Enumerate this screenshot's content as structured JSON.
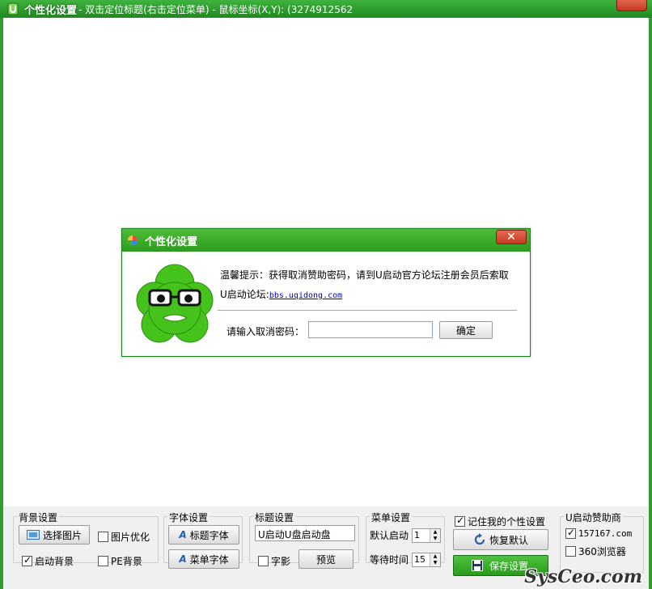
{
  "window": {
    "title": "个性化设置",
    "subtitle": "- 双击定位标题(右击定位菜单) - 鼠标坐标(X,Y): (3274912562"
  },
  "dialog": {
    "title": "个性化设置",
    "close_glyph": "✕",
    "hint": "温馨提示：获得取消赞助密码，请到U启动官方论坛注册会员后索取",
    "forum_label": "U启动论坛:",
    "forum_link": "bbs.uqidong.com",
    "password_label": "请输入取消密码：",
    "password_value": "",
    "ok_label": "确定"
  },
  "bottom": {
    "background": {
      "title": "背景设置",
      "choose_image": "选择图片",
      "optimize_image": "图片优化",
      "optimize_checked": false,
      "boot_background": "启动背景",
      "boot_checked": true,
      "pe_background": "PE背景",
      "pe_checked": false
    },
    "font": {
      "title": "字体设置",
      "title_font": "标题字体",
      "menu_font": "菜单字体"
    },
    "heading": {
      "title": "标题设置",
      "value": "U启动U盘启动盘",
      "shadow": "字影",
      "shadow_checked": false,
      "preview": "预览"
    },
    "menu": {
      "title": "菜单设置",
      "default_label": "默认启动",
      "default_value": "1",
      "wait_label": "等待时间",
      "wait_value": "15"
    },
    "remember": {
      "label": "记住我的个性设置",
      "checked": true,
      "restore": "恢复默认",
      "save": "保存设置"
    },
    "sponsor": {
      "title": "U启动赞助商",
      "item1": "157167.com",
      "item1_checked": true,
      "item2": "360浏览器",
      "item2_checked": false
    }
  },
  "watermark": "SysCeo.com",
  "colors": {
    "frame_green": "#2e9c2e",
    "title_green": "#3fb23f",
    "close_red": "#c43a22",
    "link_blue": "#0000cc"
  }
}
